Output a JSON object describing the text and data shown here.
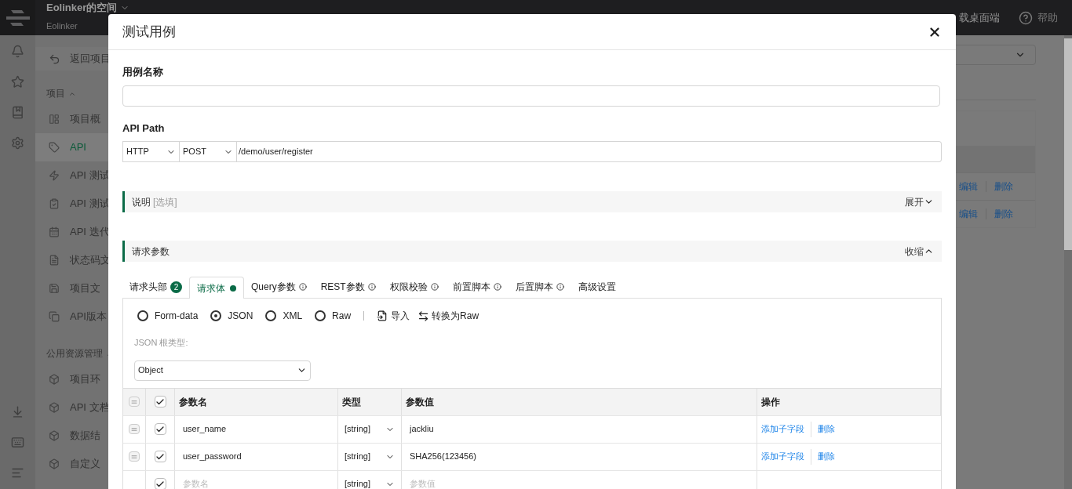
{
  "header": {
    "workspace": "Eolinker的空间",
    "subtitle": "Eolinker",
    "download": "载桌面端",
    "help": "帮助"
  },
  "sidebar": {
    "back": "返回项目",
    "groups": [
      {
        "title": "项目",
        "expanded": true,
        "items": [
          {
            "label": "项目概",
            "selected": false
          },
          {
            "label": "API",
            "selected": true
          },
          {
            "label": "API 测试",
            "selected": false
          },
          {
            "label": "API 测试",
            "selected": false
          },
          {
            "label": "API 迭代",
            "selected": false
          },
          {
            "label": "状态码文",
            "selected": false
          },
          {
            "label": "项目文",
            "selected": false
          },
          {
            "label": "API版本",
            "selected": false
          }
        ]
      },
      {
        "title": "公用资源管理",
        "expanded": true,
        "items": [
          {
            "label": "项目环",
            "selected": false
          },
          {
            "label": "API 文档",
            "selected": false
          },
          {
            "label": "数据结",
            "selected": false
          },
          {
            "label": "自定义",
            "selected": false
          }
        ]
      }
    ]
  },
  "background_rows": [
    {
      "edit": "编辑",
      "delete": "删除"
    },
    {
      "edit": "编辑",
      "delete": "删除"
    }
  ],
  "dialog": {
    "title": "测试用例",
    "name_label": "用例名称",
    "path_label": "API Path",
    "protocol": "HTTP",
    "method": "POST",
    "path": "/demo/user/register",
    "sections": [
      {
        "title": "说明",
        "hint": "[选填]",
        "toggle": "展开",
        "expanded": false
      },
      {
        "title": "请求参数",
        "toggle": "收缩",
        "expanded": true
      }
    ],
    "tabs": [
      {
        "label": "请求头部",
        "badge": "2",
        "dot": false,
        "info": false,
        "selected": false
      },
      {
        "label": "请求体",
        "dot": true,
        "info": false,
        "selected": true
      },
      {
        "label": "Query参数",
        "dot": false,
        "info": true,
        "selected": false
      },
      {
        "label": "REST参数",
        "dot": false,
        "info": true,
        "selected": false
      },
      {
        "label": "权限校验",
        "dot": false,
        "info": true,
        "selected": false
      },
      {
        "label": "前置脚本",
        "dot": false,
        "info": true,
        "selected": false
      },
      {
        "label": "后置脚本",
        "dot": false,
        "info": true,
        "selected": false
      },
      {
        "label": "高级设置",
        "dot": false,
        "info": false,
        "selected": false
      }
    ],
    "formats": [
      {
        "label": "Form-data",
        "selected": false
      },
      {
        "label": "JSON",
        "selected": true
      },
      {
        "label": "XML",
        "selected": false
      },
      {
        "label": "Raw",
        "selected": false
      }
    ],
    "import": "导入",
    "convert": "转换为Raw",
    "root_type_label": "JSON 根类型:",
    "root_type": "Object",
    "table": {
      "header_checked": true,
      "columns": [
        "参数名",
        "类型",
        "参数值",
        "操作"
      ],
      "rows": [
        {
          "kind": "param",
          "checked": true,
          "name": "user_name",
          "type": "[string]",
          "value": "jackliu",
          "actions": [
            "添加子字段",
            "删除"
          ]
        },
        {
          "kind": "param",
          "checked": true,
          "name": "user_password",
          "type": "[string]",
          "value": "SHA256(123456)",
          "actions": [
            "添加子字段",
            "删除"
          ]
        },
        {
          "kind": "new",
          "checked": true,
          "name_placeholder": "参数名",
          "type": "[string]",
          "value_placeholder": "参数值"
        }
      ]
    }
  }
}
